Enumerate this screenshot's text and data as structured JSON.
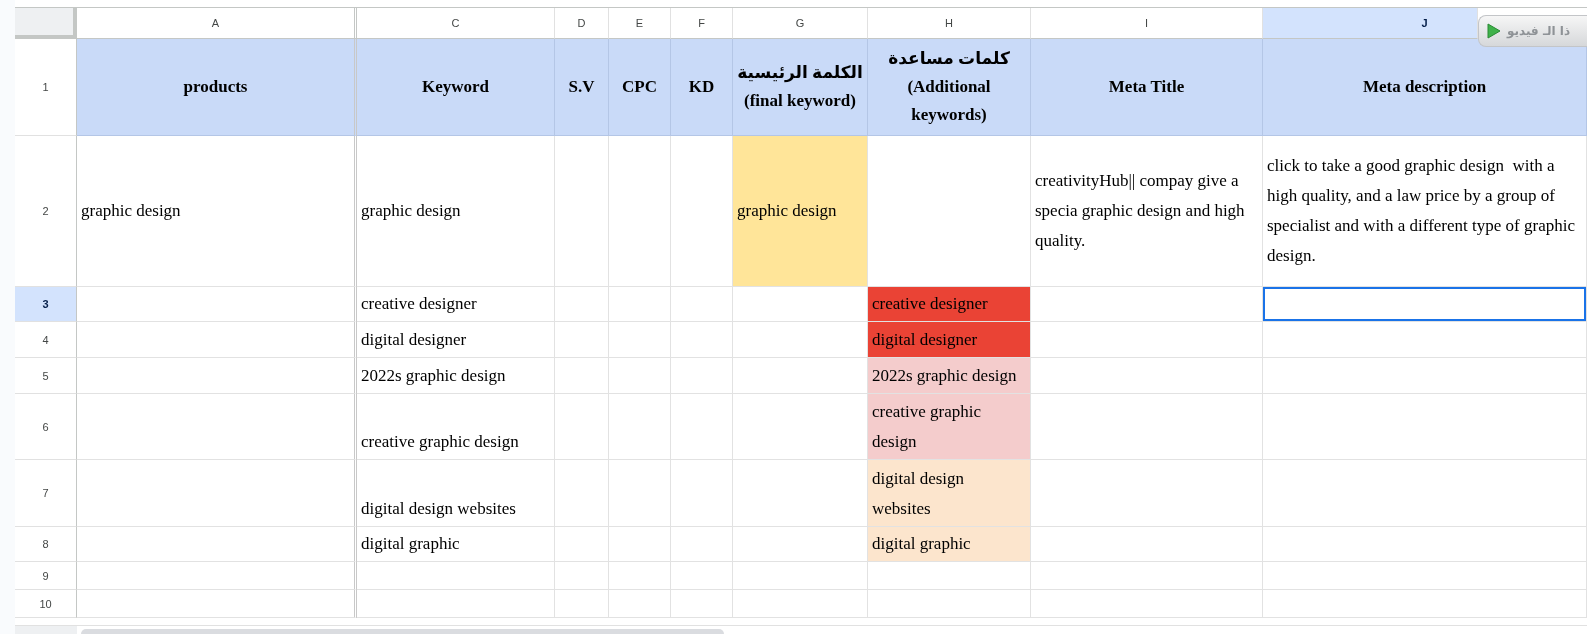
{
  "column_headers": [
    {
      "label": "A",
      "selected": false
    },
    {
      "label": "C",
      "selected": false
    },
    {
      "label": "D",
      "selected": false
    },
    {
      "label": "E",
      "selected": false
    },
    {
      "label": "F",
      "selected": false
    },
    {
      "label": "G",
      "selected": false
    },
    {
      "label": "H",
      "selected": false
    },
    {
      "label": "I",
      "selected": false
    },
    {
      "label": "J",
      "selected": true
    }
  ],
  "rows": [
    {
      "number": "1",
      "selected": false,
      "kind": "header",
      "cells": [
        {
          "text": "products",
          "selected": false
        },
        {
          "text": "Keyword",
          "selected": false
        },
        {
          "text": "S.V",
          "selected": false
        },
        {
          "text": "CPC",
          "selected": false
        },
        {
          "text": "KD",
          "selected": false
        },
        {
          "text": "الكلمة الرئيسية (final keyword)",
          "selected": false
        },
        {
          "text": "كلمات مساعدة (Additional keywords)",
          "selected": false
        },
        {
          "text": "Meta Title",
          "selected": false
        },
        {
          "text": "Meta description",
          "selected": false
        }
      ]
    },
    {
      "number": "2",
      "selected": false,
      "kind": "data",
      "cells": [
        {
          "text": "graphic design",
          "selected": false
        },
        {
          "text": "graphic design",
          "selected": false
        },
        {
          "selected": false
        },
        {
          "selected": false
        },
        {
          "selected": false
        },
        {
          "text": "graphic design",
          "color": "#ffe599",
          "selected": false
        },
        {
          "selected": false
        },
        {
          "text": "creativityHub|| compay give a specia graphic design and high quality.",
          "selected": false
        },
        {
          "text": "click to take a good graphic design  with a high quality, and a law price by a group of specialist and with a different type of graphic design.",
          "selected": false
        }
      ]
    },
    {
      "number": "3",
      "selected": true,
      "kind": "data",
      "cells": [
        {
          "selected": false
        },
        {
          "text": "creative designer",
          "selected": false
        },
        {
          "selected": false
        },
        {
          "selected": false
        },
        {
          "selected": false
        },
        {
          "selected": false
        },
        {
          "text": "creative designer",
          "color": "#ea4335",
          "selected": false
        },
        {
          "selected": false
        },
        {
          "selected": true
        }
      ]
    },
    {
      "number": "4",
      "selected": false,
      "kind": "data",
      "cells": [
        {
          "selected": false
        },
        {
          "text": "digital designer",
          "selected": false
        },
        {
          "selected": false
        },
        {
          "selected": false
        },
        {
          "selected": false
        },
        {
          "selected": false
        },
        {
          "text": "digital designer",
          "color": "#ea4335",
          "selected": false
        },
        {
          "selected": false
        },
        {
          "selected": false
        }
      ]
    },
    {
      "number": "5",
      "selected": false,
      "kind": "data",
      "cells": [
        {
          "selected": false
        },
        {
          "text": "2022s graphic design",
          "selected": false
        },
        {
          "selected": false
        },
        {
          "selected": false
        },
        {
          "selected": false
        },
        {
          "selected": false
        },
        {
          "text": "2022s graphic design",
          "color": "#f4cccc",
          "selected": false
        },
        {
          "selected": false
        },
        {
          "selected": false
        }
      ]
    },
    {
      "number": "6",
      "selected": false,
      "kind": "data",
      "cells": [
        {
          "selected": false
        },
        {
          "text": "creative graphic design",
          "selected": false
        },
        {
          "selected": false
        },
        {
          "selected": false
        },
        {
          "selected": false
        },
        {
          "selected": false
        },
        {
          "text": "creative graphic design",
          "color": "#f4cccc",
          "selected": false
        },
        {
          "selected": false
        },
        {
          "selected": false
        }
      ]
    },
    {
      "number": "7",
      "selected": false,
      "kind": "data",
      "cells": [
        {
          "selected": false
        },
        {
          "text": "digital design websites",
          "selected": false
        },
        {
          "selected": false
        },
        {
          "selected": false
        },
        {
          "selected": false
        },
        {
          "selected": false
        },
        {
          "text": "digital design websites",
          "color": "#fce5cd",
          "selected": false
        },
        {
          "selected": false
        },
        {
          "selected": false
        }
      ]
    },
    {
      "number": "8",
      "selected": false,
      "kind": "data",
      "cells": [
        {
          "selected": false
        },
        {
          "text": "digital graphic",
          "selected": false
        },
        {
          "selected": false
        },
        {
          "selected": false
        },
        {
          "selected": false
        },
        {
          "selected": false
        },
        {
          "text": "digital graphic",
          "color": "#fce5cd",
          "selected": false
        },
        {
          "selected": false
        },
        {
          "selected": false
        }
      ]
    },
    {
      "number": "9",
      "selected": false,
      "kind": "data",
      "cells": [
        {
          "selected": false
        },
        {
          "selected": false
        },
        {
          "selected": false
        },
        {
          "selected": false
        },
        {
          "selected": false
        },
        {
          "selected": false
        },
        {
          "selected": false
        },
        {
          "selected": false
        },
        {
          "selected": false
        }
      ]
    },
    {
      "number": "10",
      "selected": false,
      "kind": "data",
      "cells": [
        {
          "selected": false
        },
        {
          "selected": false
        },
        {
          "selected": false
        },
        {
          "selected": false
        },
        {
          "selected": false
        },
        {
          "selected": false
        },
        {
          "selected": false
        },
        {
          "selected": false
        },
        {
          "selected": false
        }
      ]
    }
  ],
  "overlay_button": {
    "label": "ذا الـ فيديو"
  }
}
